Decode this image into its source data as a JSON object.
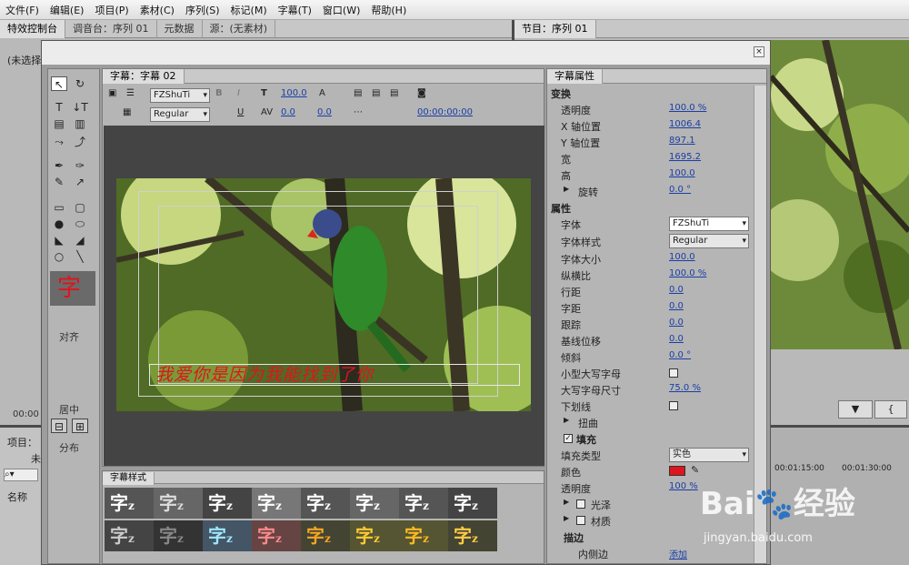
{
  "menubar": [
    "文件(F)",
    "编辑(E)",
    "项目(P)",
    "素材(C)",
    "序列(S)",
    "标记(M)",
    "字幕(T)",
    "窗口(W)",
    "帮助(H)"
  ],
  "left_panel": {
    "tabs": [
      "特效控制台",
      "调音台：序列 01",
      "元数据",
      "源：(无素材)"
    ],
    "unselected": "(未选择",
    "timecode": "00:00",
    "project_tab": "项目：",
    "name_col": "名称",
    "item_prefix": "未"
  },
  "program": {
    "tab": "节目：序列 01",
    "timecodes": [
      "00:01:15:00",
      "00:01:30:00"
    ]
  },
  "title_window": {
    "designer_tab": "字幕：字幕 02",
    "font_family": "FZShuTi",
    "font_style": "Regular",
    "size": "100.0",
    "kerning": "0.0",
    "leading": "0.0",
    "timecode": "00:00:00:00",
    "caption_text": "我爱你是因为我能找到了你",
    "align_label": "对齐",
    "center_label": "居中",
    "distribute_label": "分布",
    "styles_tab": "字幕样式",
    "style_glyph": "字",
    "style_sub": "z",
    "tool_preview": "字",
    "properties_tab": "字幕属性"
  },
  "properties": {
    "transform_header": "变换",
    "opacity_label": "透明度",
    "opacity": "100.0 %",
    "xpos_label": "X 轴位置",
    "xpos": "1006.4",
    "ypos_label": "Y 轴位置",
    "ypos": "897.1",
    "width_label": "宽",
    "width": "1695.2",
    "height_label": "高",
    "height": "100.0",
    "rotation_label": "旋转",
    "rotation": "0.0 °",
    "attributes_header": "属性",
    "font_label": "字体",
    "font": "FZShuTi",
    "font_style_label": "字体样式",
    "font_style": "Regular",
    "font_size_label": "字体大小",
    "font_size": "100.0",
    "aspect_label": "纵横比",
    "aspect": "100.0 %",
    "leading_label": "行距",
    "leading": "0.0",
    "kerning_label": "字距",
    "kerning": "0.0",
    "tracking_label": "跟踪",
    "tracking": "0.0",
    "baseline_label": "基线位移",
    "baseline": "0.0",
    "slant_label": "倾斜",
    "slant": "0.0 °",
    "smallcaps_label": "小型大写字母",
    "smallcaps_size_label": "大写字母尺寸",
    "smallcaps_size": "75.0 %",
    "underline_label": "下划线",
    "distort_label": "扭曲",
    "fill_header": "填充",
    "fill_type_label": "填充类型",
    "fill_type": "实色",
    "color_label": "颜色",
    "color_hex": "#e0141c",
    "fill_opacity_label": "透明度",
    "fill_opacity": "100 %",
    "sheen_label": "光泽",
    "texture_label": "材质",
    "stroke_header": "描边",
    "inner_stroke_label": "内侧边",
    "add_label": "添加"
  },
  "watermark": {
    "logo": "Bai",
    "cn": "经验",
    "url": "jingyan.baidu.com"
  }
}
